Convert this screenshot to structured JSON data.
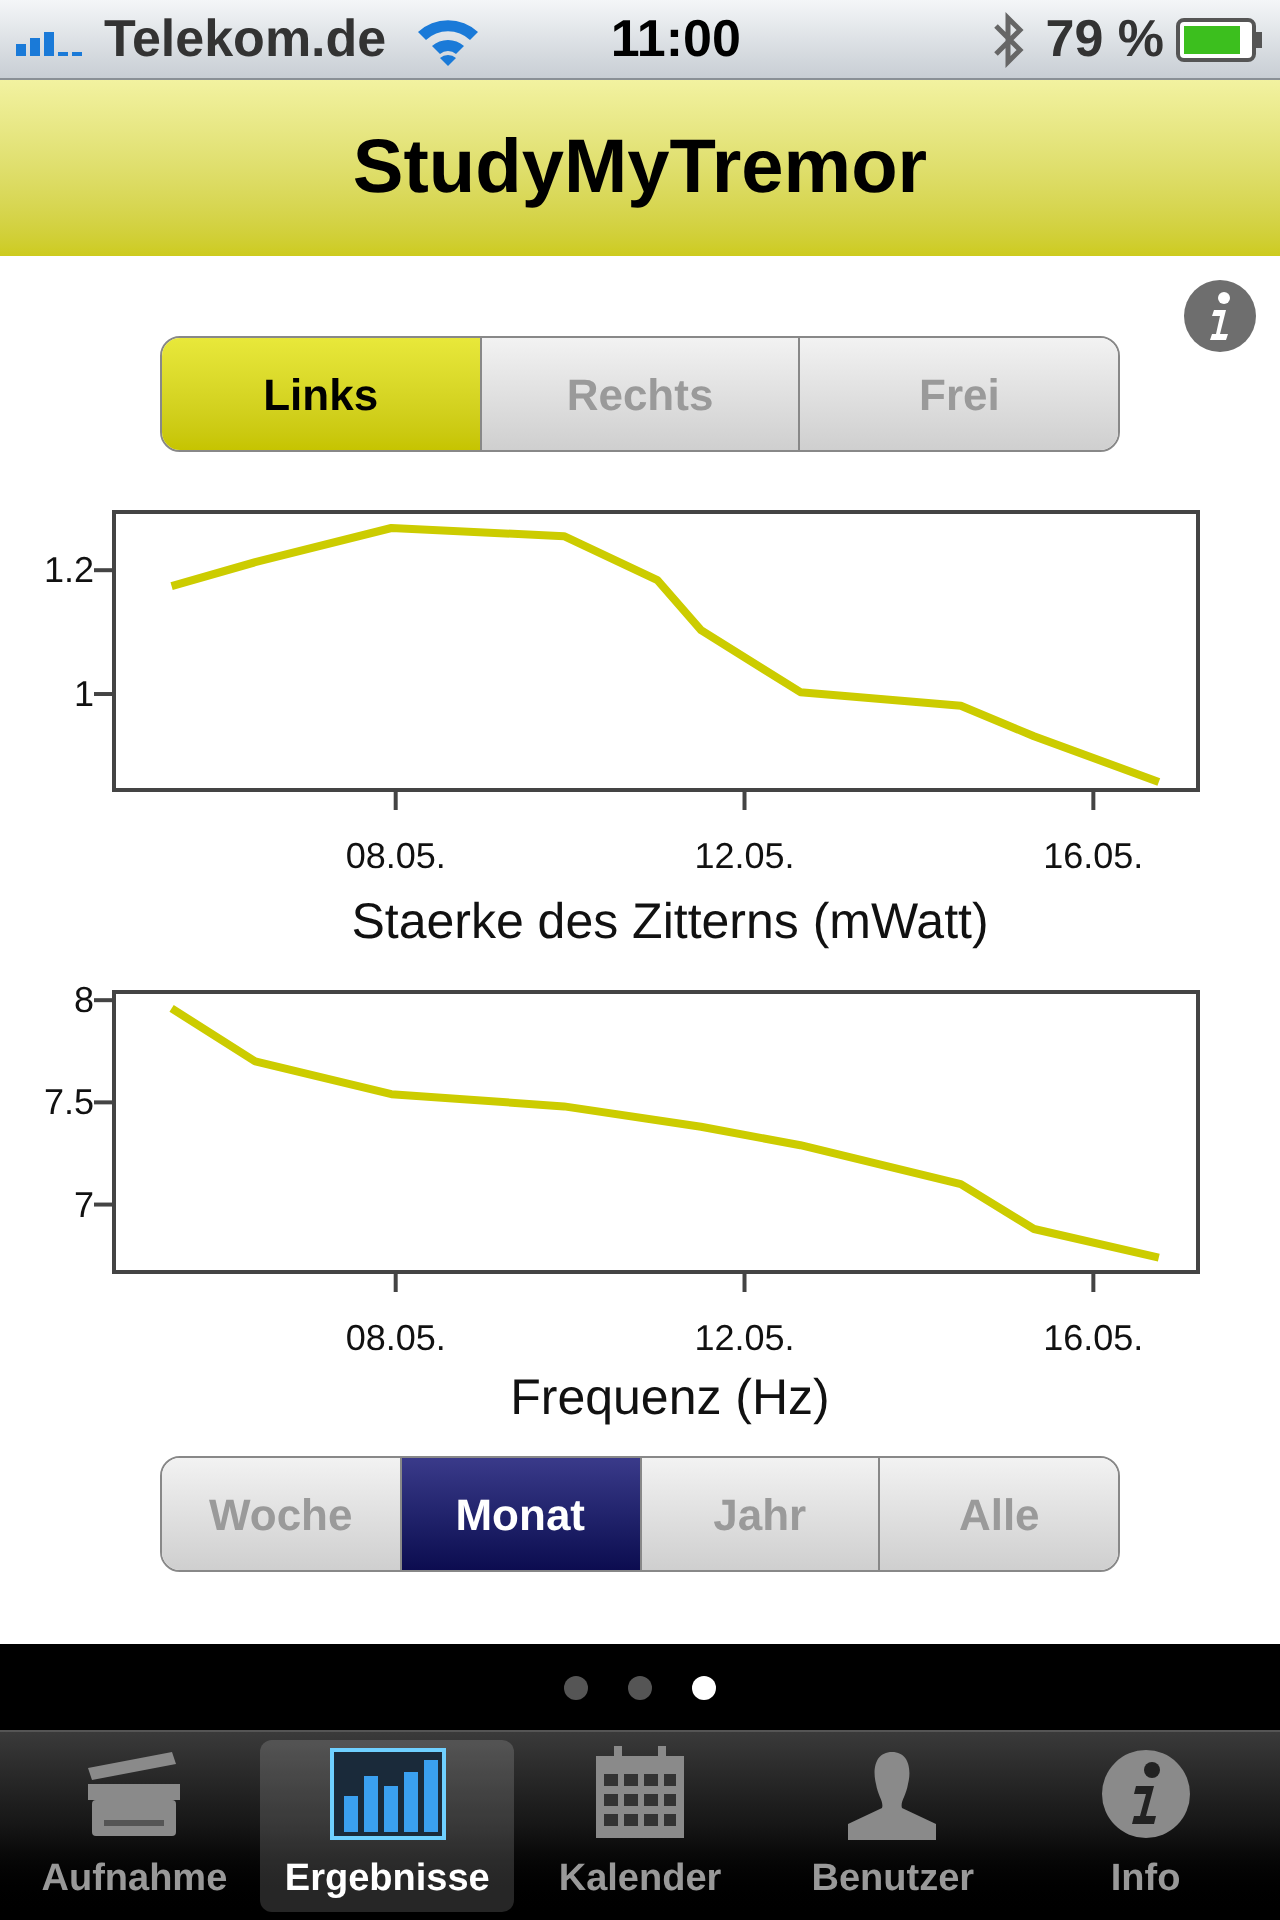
{
  "status_bar": {
    "carrier": "Telekom.de",
    "time": "11:00",
    "battery": "79 %"
  },
  "nav_bar": {
    "title": "StudyMyTremor"
  },
  "hand_selector": [
    {
      "label": "Links",
      "selected": true
    },
    {
      "label": "Rechts",
      "selected": false
    },
    {
      "label": "Frei",
      "selected": false
    }
  ],
  "charts": [
    {
      "chart_data": {
        "type": "line",
        "xlabel": "Staerke des Zitterns (mWatt)",
        "x": [
          5.48,
          6.44,
          8.0,
          9.98,
          11.05,
          11.55,
          12.69,
          14.53,
          15.37,
          16.8
        ],
        "series": [
          {
            "color": "#cccc00",
            "values": [
              1.174,
              1.213,
              1.268,
              1.255,
              1.184,
              1.103,
              1.003,
              0.981,
              0.932,
              0.858
            ]
          }
        ],
        "xlim": [
          4.82,
          17.25
        ],
        "ylim": [
          0.845,
          1.294
        ],
        "xticks": [
          {
            "value": 8.05,
            "label": "08.05."
          },
          {
            "value": 12.05,
            "label": "12.05."
          },
          {
            "value": 16.05,
            "label": "16.05."
          }
        ],
        "yticks": [
          {
            "value": 1,
            "label": "1"
          },
          {
            "value": 1.2,
            "label": "1.2"
          }
        ]
      }
    },
    {
      "chart_data": {
        "type": "line",
        "xlabel": "Frequenz (Hz)",
        "x": [
          5.48,
          6.44,
          8.0,
          9.98,
          11.55,
          12.69,
          14.53,
          15.37,
          16.8
        ],
        "series": [
          {
            "color": "#cccc00",
            "values": [
              7.96,
              7.7,
              7.54,
              7.48,
              7.38,
              7.29,
              7.1,
              6.88,
              6.74
            ]
          }
        ],
        "xlim": [
          4.82,
          17.25
        ],
        "ylim": [
          6.67,
          8.04
        ],
        "xticks": [
          {
            "value": 8.05,
            "label": "08.05."
          },
          {
            "value": 12.05,
            "label": "12.05."
          },
          {
            "value": 16.05,
            "label": "16.05."
          }
        ],
        "yticks": [
          {
            "value": 7,
            "label": "7"
          },
          {
            "value": 7.5,
            "label": "7.5"
          },
          {
            "value": 8,
            "label": "8"
          }
        ]
      }
    }
  ],
  "period_selector": [
    {
      "label": "Woche",
      "selected": false
    },
    {
      "label": "Monat",
      "selected": true
    },
    {
      "label": "Jahr",
      "selected": false
    },
    {
      "label": "Alle",
      "selected": false
    }
  ],
  "page_dots": [
    {
      "selected": false
    },
    {
      "selected": false
    },
    {
      "selected": true
    }
  ],
  "tab_bar": [
    {
      "label": "Aufnahme",
      "selected": false
    },
    {
      "label": "Ergebnisse",
      "selected": true
    },
    {
      "label": "Kalender",
      "selected": false
    },
    {
      "label": "Benutzer",
      "selected": false
    },
    {
      "label": "Info",
      "selected": false
    }
  ]
}
